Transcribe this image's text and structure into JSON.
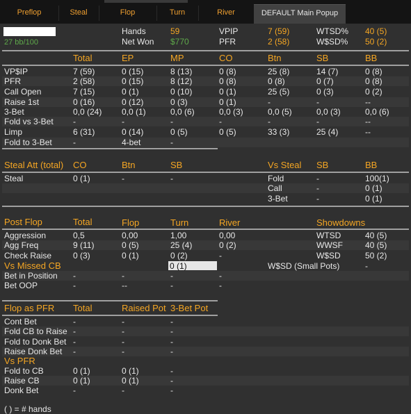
{
  "tabs": [
    {
      "label": "Preflop"
    },
    {
      "label": "Steal"
    },
    {
      "label": "Flop"
    },
    {
      "label": "Turn"
    },
    {
      "label": "River"
    },
    {
      "label": "DEFAULT Main Popup"
    }
  ],
  "summary": {
    "stack": "27 bb/100",
    "hands_label": "Hands",
    "hands_value": "59",
    "netwon_label": "Net Won",
    "netwon_value": "$770",
    "vpip_label": "VPIP",
    "vpip_value": "7 (59)",
    "pfr_label": "PFR",
    "pfr_value": "2 (58)",
    "wtsd_label": "WTSD%",
    "wtsd_value": "40 (5)",
    "wsd_label": "W$SD%",
    "wsd_value": "50 (2)"
  },
  "preflop": {
    "headers": [
      "Total",
      "EP",
      "MP",
      "CO",
      "Btn",
      "SB",
      "BB"
    ],
    "rows": [
      {
        "label": "VP$IP",
        "cells": [
          "7 (59)",
          "0 (15)",
          "8 (13)",
          "0 (8)",
          "25 (8)",
          "14 (7)",
          "0 (8)"
        ]
      },
      {
        "label": "PFR",
        "cells": [
          "2 (58)",
          "0 (15)",
          "8 (12)",
          "0 (8)",
          "0 (8)",
          "0 (7)",
          "0 (8)"
        ]
      },
      {
        "label": "Call Open",
        "cells": [
          "7 (15)",
          "0 (1)",
          "0 (10)",
          "0 (1)",
          "25 (5)",
          "0 (3)",
          "0 (2)"
        ]
      },
      {
        "label": "Raise 1st",
        "cells": [
          "0 (16)",
          "0 (12)",
          "0 (3)",
          "0 (1)",
          "-",
          "-",
          "--"
        ]
      },
      {
        "label": "3-Bet",
        "cells": [
          "0,0 (24)",
          "0,0 (1)",
          "0,0 (6)",
          "0,0 (3)",
          "0,0 (5)",
          "0,0 (3)",
          "0,0 (6)"
        ]
      },
      {
        "label": "Fold vs 3-Bet",
        "cells": [
          "-",
          "-",
          "-",
          "-",
          "-",
          "-",
          "--"
        ]
      },
      {
        "label": "Limp",
        "cells": [
          "6 (31)",
          "0 (14)",
          "0 (5)",
          "0 (5)",
          "33 (3)",
          "25 (4)",
          "--"
        ]
      },
      {
        "label": "Fold to 3-Bet",
        "cells": [
          "-",
          "4-bet",
          "-",
          "",
          "",
          "",
          ""
        ]
      }
    ]
  },
  "steal": {
    "title": "Steal Att (total)",
    "headers": [
      "CO",
      "Btn",
      "SB"
    ],
    "row_label": "Steal",
    "row_cells": [
      "0 (1)",
      "-",
      "-"
    ],
    "vs_title": "Vs Steal",
    "vs_headers": [
      "SB",
      "BB"
    ],
    "vs_rows": [
      {
        "label": "Fold",
        "cells": [
          "-",
          "100(1)"
        ]
      },
      {
        "label": "Call",
        "cells": [
          "-",
          "0 (1)"
        ]
      },
      {
        "label": "3-Bet",
        "cells": [
          "-",
          "0 (1)"
        ]
      }
    ]
  },
  "postflop": {
    "title": "Post Flop",
    "headers": [
      "Total",
      "Flop",
      "Turn",
      "River"
    ],
    "rows": [
      {
        "label": "Aggression",
        "cells": [
          "0,5",
          "0,00",
          "1,00",
          "0,00"
        ]
      },
      {
        "label": "Agg Freq",
        "cells": [
          "9 (11)",
          "0 (5)",
          "25 (4)",
          "0 (2)"
        ]
      },
      {
        "label": "Check Raise",
        "cells": [
          "0 (3)",
          "0 (1)",
          "0 (2)",
          "-"
        ]
      }
    ],
    "missed_label": "Vs Missed CB",
    "missed_value": "0 (1)",
    "rows2": [
      {
        "label": "Bet in Position",
        "cells": [
          "-",
          "-",
          "-",
          "-"
        ]
      },
      {
        "label": "Bet OOP",
        "cells": [
          "-",
          "--",
          "-",
          "-"
        ]
      }
    ],
    "showdowns_title": "Showdowns",
    "showdowns": [
      {
        "label": "WTSD",
        "value": "40 (5)"
      },
      {
        "label": "WWSF",
        "value": "40 (5)"
      },
      {
        "label": "W$SD",
        "value": "50 (2)"
      },
      {
        "label": "W$SD (Small Pots)",
        "value": "-"
      }
    ]
  },
  "pfr_section": {
    "title": "Flop as PFR",
    "headers": [
      "Total",
      "Raised Pot",
      "3-Bet Pot"
    ],
    "rows": [
      {
        "label": "Cont Bet",
        "cells": [
          "-",
          "-",
          "-"
        ]
      },
      {
        "label": "Fold CB to Raise",
        "cells": [
          "-",
          "-",
          "-"
        ]
      },
      {
        "label": "Fold to Donk Bet",
        "cells": [
          "-",
          "-",
          "-"
        ]
      },
      {
        "label": "Raise Donk Bet",
        "cells": [
          "-",
          "-",
          "-"
        ]
      }
    ],
    "vs_title": "Vs PFR",
    "vs_rows": [
      {
        "label": "Fold to CB",
        "cells": [
          "0 (1)",
          "0 (1)",
          "-"
        ]
      },
      {
        "label": "Raise CB",
        "cells": [
          "0 (1)",
          "0 (1)",
          "-"
        ]
      },
      {
        "label": "Donk Bet",
        "cells": [
          "-",
          "-",
          "-"
        ]
      }
    ]
  },
  "footer": "( ) = # hands"
}
